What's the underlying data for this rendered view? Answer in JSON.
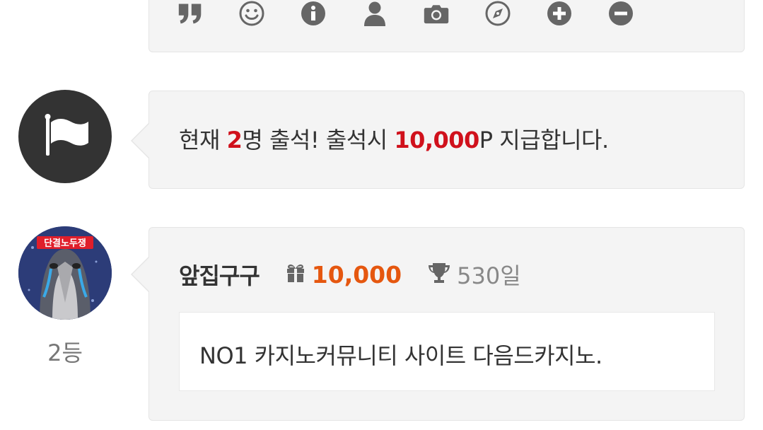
{
  "toolbar": {
    "icons": [
      "quote-icon",
      "smile-icon",
      "info-icon",
      "user-icon",
      "camera-icon",
      "compass-icon",
      "plus-circle-icon",
      "minus-circle-icon"
    ]
  },
  "notice": {
    "icon": "flag-icon",
    "text_prefix": "현재 ",
    "count": "2",
    "text_middle": "명 출석! 출석시 ",
    "amount": "10,000",
    "text_suffix": "P 지급합니다."
  },
  "entry": {
    "nickname": "앞집구구",
    "points": "10,000",
    "days": "530일",
    "rank": "2등",
    "message": "NO1 카지노커뮤니티 사이트 다음드카지노.",
    "avatar_badge": "단결노두쟁"
  },
  "colors": {
    "red": "#d0111c",
    "orange": "#e5570f",
    "icon_gray": "#666666",
    "box_bg": "#f4f4f4"
  }
}
